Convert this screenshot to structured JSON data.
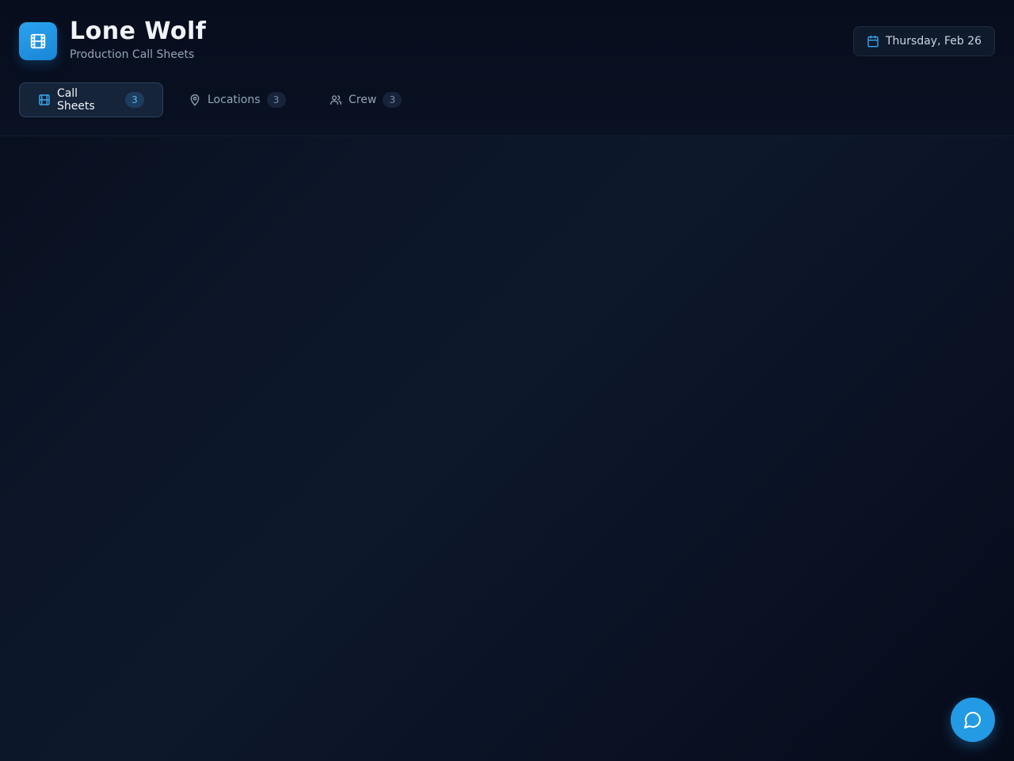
{
  "app": {
    "title": "Lone Wolf",
    "subtitle": "Production Call Sheets"
  },
  "header": {
    "date": "Thursday, Feb 26"
  },
  "tabs": [
    {
      "label": "Call Sheets",
      "count": "3",
      "icon": "film-icon",
      "active": true
    },
    {
      "label": "Locations",
      "count": "3",
      "icon": "map-pin-icon",
      "active": false
    },
    {
      "label": "Crew",
      "count": "3",
      "icon": "users-icon",
      "active": false
    }
  ],
  "colors": {
    "accent": "#239ae4",
    "background": "#0c1628"
  },
  "chat": {
    "icon": "chat-bubble-icon"
  }
}
